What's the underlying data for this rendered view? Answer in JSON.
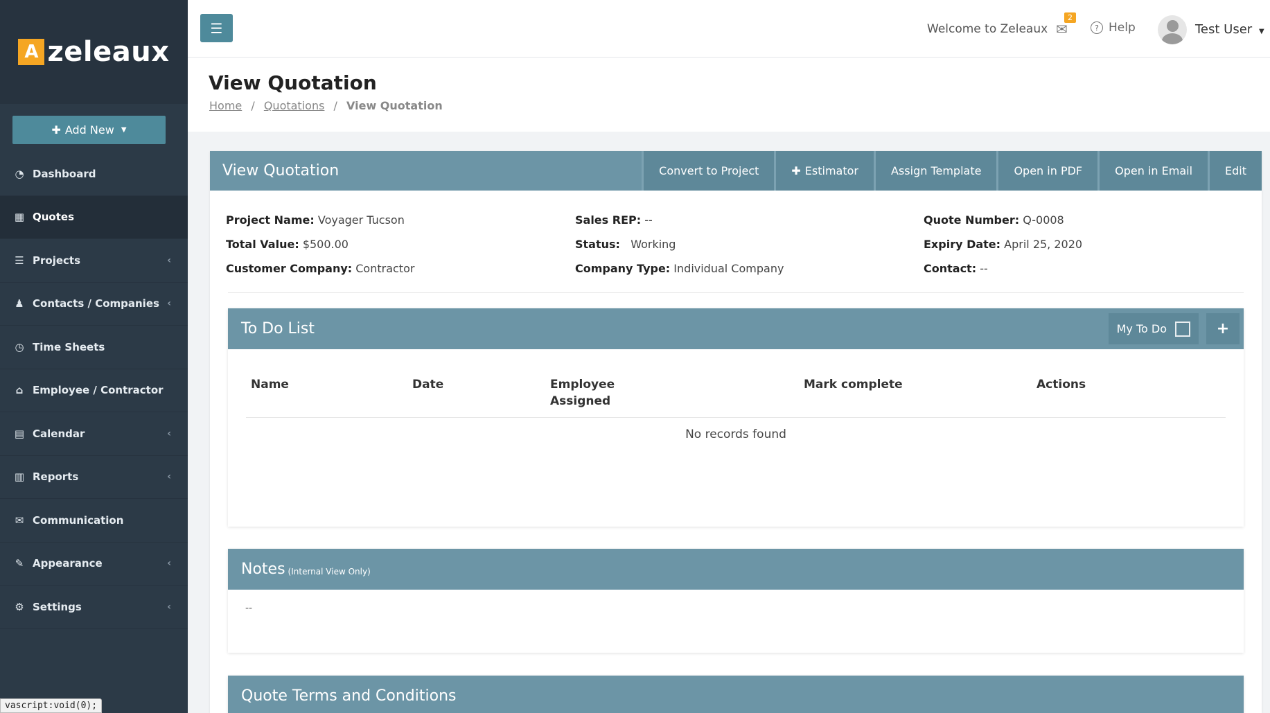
{
  "brand": {
    "logo_letter": "A",
    "name": "zeleaux",
    "accent": "#4e8a9b",
    "badge_color": "#f5a623",
    "header_color": "#6c95a6"
  },
  "sidebar": {
    "add_new": "Add New",
    "items": [
      {
        "label": "Dashboard",
        "icon": "dashboard-icon"
      },
      {
        "label": "Quotes",
        "icon": "calculator-icon"
      },
      {
        "label": "Projects",
        "icon": "list-icon"
      },
      {
        "label": "Contacts / Companies",
        "icon": "user-icon"
      },
      {
        "label": "Time Sheets",
        "icon": "clock-icon"
      },
      {
        "label": "Employee / Contractor",
        "icon": "bank-icon"
      },
      {
        "label": "Calendar",
        "icon": "calendar-icon"
      },
      {
        "label": "Reports",
        "icon": "bar-chart-icon"
      },
      {
        "label": "Communication",
        "icon": "envelope-icon"
      },
      {
        "label": "Appearance",
        "icon": "brush-icon"
      },
      {
        "label": "Settings",
        "icon": "gear-icon"
      }
    ]
  },
  "status_bar": "vascript:void(0);",
  "topbar": {
    "welcome": "Welcome to Zeleaux",
    "mail_count": "2",
    "help": "Help",
    "user": "Test User"
  },
  "page": {
    "title": "View Quotation",
    "breadcrumb": {
      "home": "Home",
      "quotations": "Quotations",
      "current": "View Quotation"
    }
  },
  "card": {
    "title": "View Quotation",
    "actions": {
      "convert": "Convert to Project",
      "estimator": "Estimator",
      "assign": "Assign Template",
      "pdf": "Open in PDF",
      "email": "Open in Email",
      "edit": "Edit"
    },
    "info": {
      "project_name_label": "Project Name:",
      "project_name": "Voyager Tucson",
      "total_value_label": "Total Value:",
      "total_value": "$500.00",
      "customer_company_label": "Customer Company:",
      "customer_company": "Contractor",
      "sales_rep_label": "Sales REP:",
      "sales_rep": "--",
      "status_label": "Status:",
      "status": "Working",
      "company_type_label": "Company Type:",
      "company_type": "Individual Company",
      "quote_number_label": "Quote Number:",
      "quote_number": "Q-0008",
      "expiry_date_label": "Expiry Date:",
      "expiry_date": "April 25, 2020",
      "contact_label": "Contact:",
      "contact": "--"
    }
  },
  "todo": {
    "title": "To Do List",
    "my_todo": "My To Do",
    "columns": [
      "Name",
      "Date",
      "Employee Assigned",
      "Mark complete",
      "Actions"
    ],
    "empty": "No records found"
  },
  "notes": {
    "title": "Notes",
    "subtitle": "(Internal View Only)",
    "body": "--"
  },
  "terms": {
    "title": "Quote Terms and Conditions"
  }
}
